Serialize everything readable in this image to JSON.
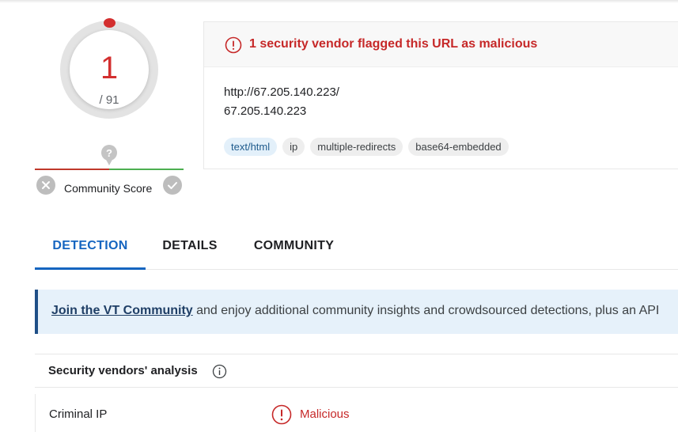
{
  "score": {
    "detections": "1",
    "total": "/ 91"
  },
  "community": {
    "label": "Community Score"
  },
  "header": {
    "alert": "1 security vendor flagged this URL as malicious",
    "url": "http://67.205.140.223/",
    "host": "67.205.140.223",
    "tags": [
      "text/html",
      "ip",
      "multiple-redirects",
      "base64-embedded"
    ]
  },
  "tabs": [
    {
      "label": "DETECTION",
      "active": true
    },
    {
      "label": "DETAILS",
      "active": false
    },
    {
      "label": "COMMUNITY",
      "active": false
    }
  ],
  "join_banner": {
    "link": "Join the VT Community",
    "text": " and enjoy additional community insights and crowdsourced detections, plus an API"
  },
  "vendors": {
    "title": "Security vendors' analysis",
    "rows": [
      {
        "name": "Criminal IP",
        "verdict": "Malicious"
      }
    ]
  },
  "colors": {
    "malicious": "#c62828",
    "accent": "#1565c0",
    "banner_border": "#1f4f87"
  },
  "icons": [
    "alert-circle-icon",
    "question-marker-icon",
    "close-icon",
    "check-icon",
    "info-icon"
  ]
}
